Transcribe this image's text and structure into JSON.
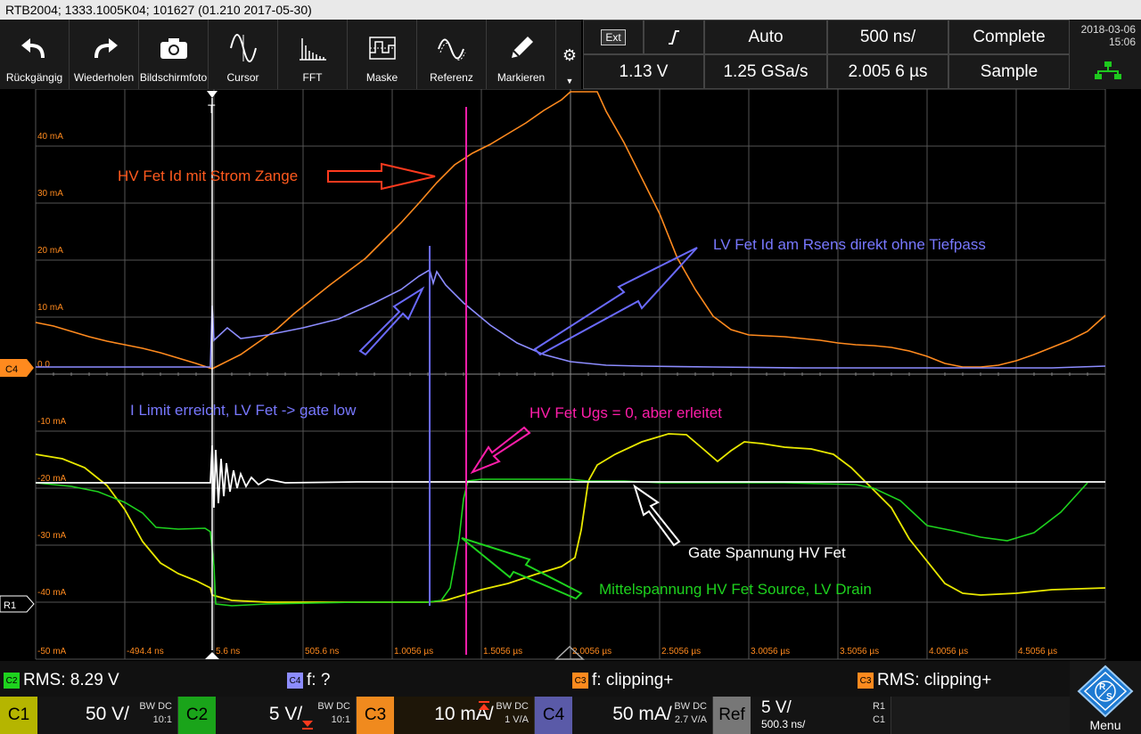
{
  "title_bar": "RTB2004; 1333.1005K04; 101627 (01.210 2017-05-30)",
  "toolbar": [
    {
      "label": "Rückgängig",
      "icon": "undo-icon"
    },
    {
      "label": "Wiederholen",
      "icon": "redo-icon"
    },
    {
      "label": "Bildschirmfoto",
      "icon": "camera-icon"
    },
    {
      "label": "Cursor",
      "icon": "cursor-icon"
    },
    {
      "label": "FFT",
      "icon": "fft-icon"
    },
    {
      "label": "Maske",
      "icon": "mask-icon"
    },
    {
      "label": "Referenz",
      "icon": "reference-icon"
    },
    {
      "label": "Markieren",
      "icon": "pencil-icon"
    }
  ],
  "status": {
    "trigger_source": "Ext",
    "edge_icon": "rising-edge-icon",
    "trigger_mode": "Auto",
    "timebase": "500 ns/",
    "acq_state": "Complete",
    "trigger_level": "1.13 V",
    "sample_rate": "1.25 GSa/s",
    "position": "2.005 6 µs",
    "acq_mode": "Sample"
  },
  "datetime": {
    "date": "2018-03-06",
    "time": "15:06"
  },
  "y_labels": [
    "40 mA",
    "30 mA",
    "20 mA",
    "10 mA",
    "0.0",
    "-10 mA",
    "-20 mA",
    "-30 mA",
    "-40 mA",
    "-50 mA"
  ],
  "x_labels": [
    "-494.4 ns",
    "5.6 ns",
    "505.6 ns",
    "1.0056 µs",
    "1.5056 µs",
    "2.0056 µs",
    "2.5056 µs",
    "3.0056 µs",
    "3.5056 µs",
    "4.0056 µs",
    "4.5056 µs"
  ],
  "markers": {
    "trigger_t": "T",
    "ch_ground": "C4",
    "ref": "R1"
  },
  "annotations": {
    "hv_id": "HV Fet Id mit Strom Zange",
    "lv_id": "LV Fet Id am Rsens direkt ohne Tiefpass",
    "ilimit": "I Limit erreicht, LV Fet -> gate low",
    "ugs": "HV Fet Ugs = 0, aber erleitet",
    "gate": "Gate Spannung HV Fet",
    "mittel": "Mittelspannung HV Fet Source, LV Drain"
  },
  "colors": {
    "c1": "#e8e800",
    "c2": "#1ed21e",
    "c3": "#ff8a1e",
    "c4": "#8c8cff",
    "white_trace": "#ffffff",
    "hv_label": "#ff5a1e",
    "lv_label": "#7878ff",
    "ugs_label": "#ff1eaa"
  },
  "measurements": [
    {
      "tag": "C2",
      "text": "RMS: 8.29 V",
      "color": "#1ed21e"
    },
    {
      "tag": "C4",
      "text": "f: ?",
      "color": "#8c8cff"
    },
    {
      "tag": "C3",
      "text": "f: clipping+",
      "color": "#ff8a1e"
    },
    {
      "tag": "C3",
      "text": "RMS: clipping+",
      "color": "#ff8a1e"
    }
  ],
  "channels": [
    {
      "name": "C1",
      "value": "50 V/",
      "bw": "BW DC",
      "probe": "10:1",
      "color": "#b5b500"
    },
    {
      "name": "C2",
      "value": "5 V/",
      "bw": "BW DC",
      "probe": "10:1",
      "color": "#1aa41a"
    },
    {
      "name": "C3",
      "value": "10 mA/",
      "bw": "BW DC",
      "probe": "1 V/A",
      "color": "#f08a1e"
    },
    {
      "name": "C4",
      "value": "50 mA/",
      "bw": "BW DC",
      "probe": "2.7 V/A",
      "color": "#5a5aa8"
    }
  ],
  "ref": {
    "name": "Ref",
    "value": "5 V/",
    "time": "500.3 ns/",
    "r1": "R1",
    "c1": "C1"
  },
  "menu": {
    "label": "Menu"
  }
}
